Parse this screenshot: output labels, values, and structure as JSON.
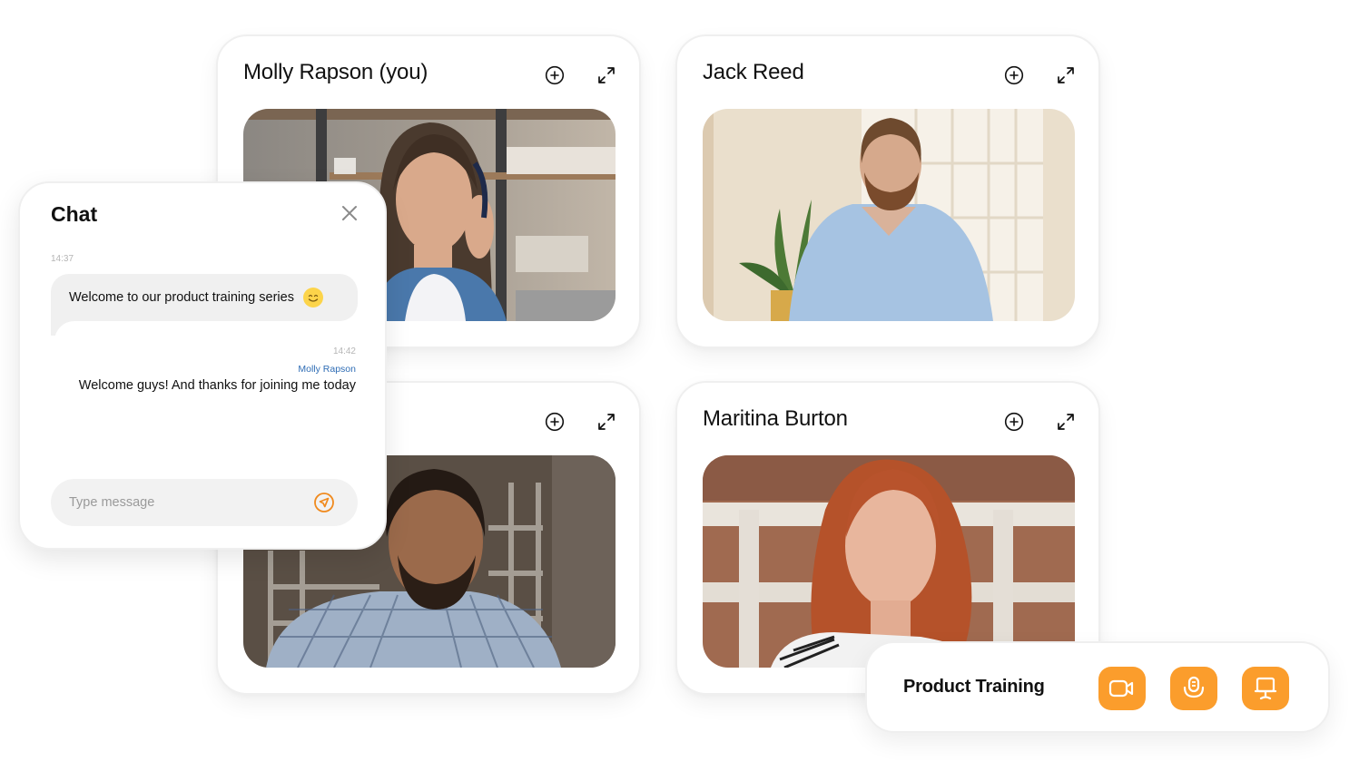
{
  "participants": [
    {
      "name": "Molly Rapson (you)",
      "photo": "woman-with-headphones"
    },
    {
      "name": "Jack Reed",
      "photo": "bearded-man-blue-shirt"
    },
    {
      "name": "",
      "photo": "man-plaid-shirt"
    },
    {
      "name": "Maritina Burton",
      "photo": "red-haired-woman"
    }
  ],
  "card_icons": {
    "add": "add-circle-icon",
    "expand": "expand-icon"
  },
  "chat": {
    "title": "Chat",
    "close_icon": "close-icon",
    "messages": [
      {
        "time": "14:37",
        "sender": "",
        "text": "Welcome to our product training series",
        "emoji": "smiling-face",
        "direction": "incoming"
      },
      {
        "time": "14:42",
        "sender": "Molly Rapson",
        "text": "Welcome guys! And thanks for joining me today",
        "direction": "outgoing"
      }
    ],
    "input_placeholder": "Type message",
    "input_value": "",
    "send_icon": "send-icon"
  },
  "controls": {
    "title": "Product Training",
    "buttons": [
      {
        "label": "Camera",
        "icon": "video-camera-icon"
      },
      {
        "label": "Microphone",
        "icon": "microphone-icon"
      },
      {
        "label": "Share screen",
        "icon": "presentation-icon"
      }
    ]
  },
  "colors": {
    "accent": "#fb9d2c",
    "sender": "#2f6db5",
    "bubble": "#f0f0f0"
  }
}
